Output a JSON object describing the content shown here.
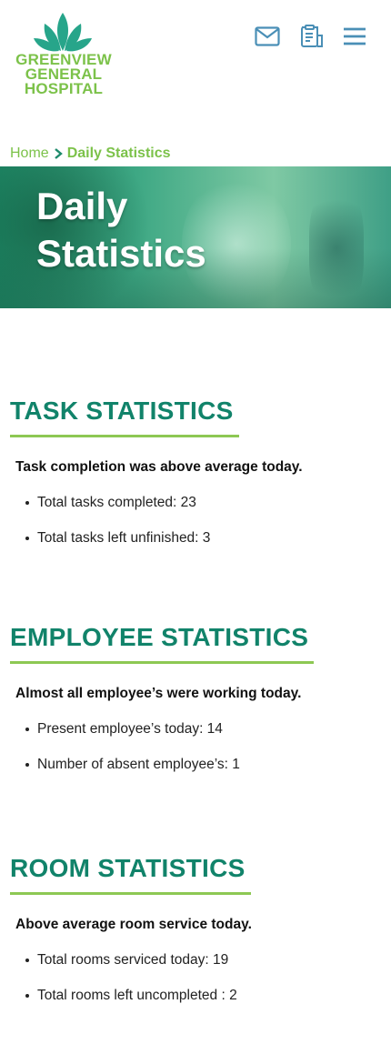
{
  "header": {
    "logo_lines": [
      "GREENVIEW",
      "GENERAL",
      "HOSPITAL"
    ],
    "icons": [
      "mail-icon",
      "clipboard-icon",
      "menu-icon"
    ]
  },
  "breadcrumb": {
    "home": "Home",
    "current": "Daily Statistics"
  },
  "hero": {
    "title_line1": "Daily",
    "title_line2": "Statistics"
  },
  "sections": [
    {
      "title": "TASK STATISTICS",
      "summary": "Task completion was above average today.",
      "items": [
        "Total tasks completed: 23",
        "Total tasks left unfinished: 3"
      ]
    },
    {
      "title": "EMPLOYEE STATISTICS",
      "summary": "Almost all employee’s were working today.",
      "items": [
        "Present employee’s today: 14",
        "Number of absent employee’s: 1"
      ]
    },
    {
      "title": "ROOM STATISTICS",
      "summary": "Above average room service today.",
      "items": [
        "Total rooms serviced today: 19",
        "Total rooms left uncompleted : 2"
      ]
    }
  ],
  "colors": {
    "brand_green": "#7cc24a",
    "heading_teal": "#11836a",
    "underline_green": "#8dc853",
    "icon_blue": "#4a8fb6"
  }
}
